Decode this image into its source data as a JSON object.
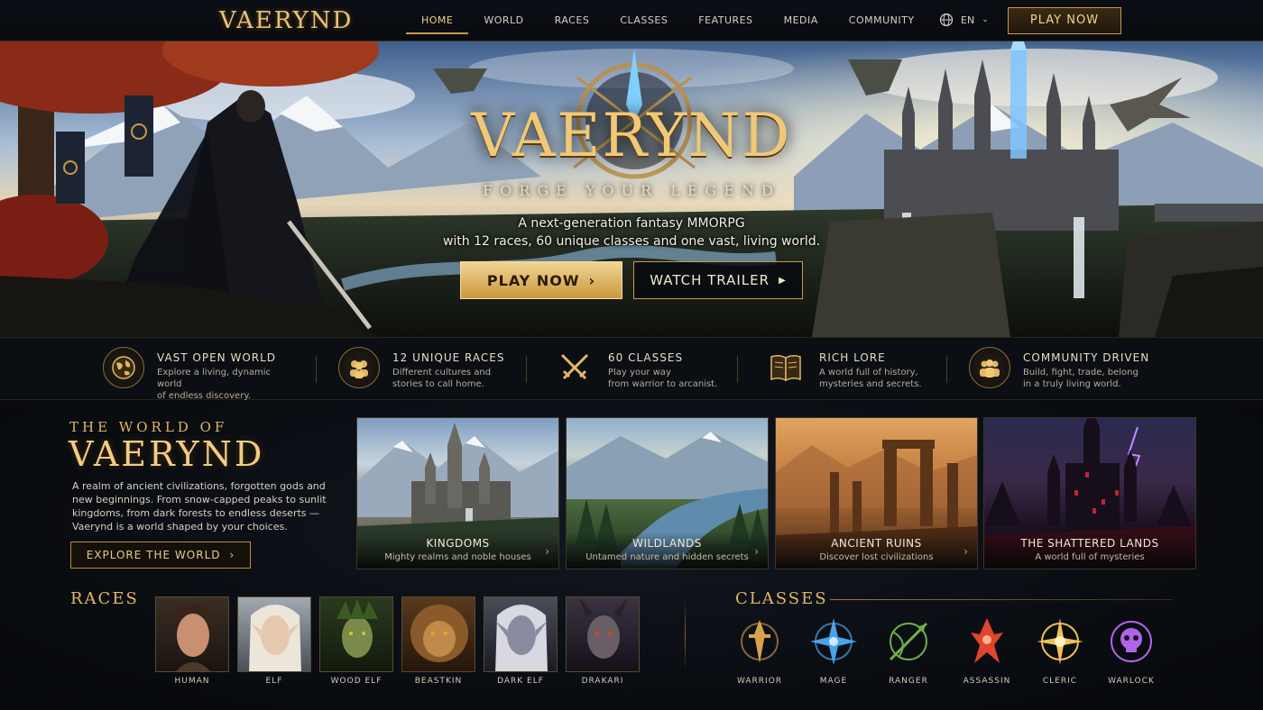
{
  "nav": {
    "logo": "VAERYND",
    "items": [
      "HOME",
      "WORLD",
      "RACES",
      "CLASSES",
      "FEATURES",
      "MEDIA",
      "COMMUNITY"
    ],
    "active": "HOME",
    "language": "EN",
    "play_label": "PLAY NOW"
  },
  "hero": {
    "title": "VAERYND",
    "tagline": "FORGE YOUR LEGEND",
    "subtitle_line1": "A next-generation fantasy MMORPG",
    "subtitle_line2": "with 12 races, 60 unique classes and one vast, living world.",
    "play_label": "PLAY NOW",
    "trailer_label": "WATCH TRAILER"
  },
  "features": [
    {
      "icon": "globe-icon",
      "title": "VAST OPEN WORLD",
      "line1": "Explore a living, dynamic world",
      "line2": "of endless discovery."
    },
    {
      "icon": "people-icon",
      "title": "12 UNIQUE RACES",
      "line1": "Different cultures and",
      "line2": "stories to call home."
    },
    {
      "icon": "crossed-swords-icon",
      "title": "60 CLASSES",
      "line1": "Play your way",
      "line2": "from warrior to arcanist."
    },
    {
      "icon": "book-icon",
      "title": "RICH LORE",
      "line1": "A world full of history,",
      "line2": "mysteries and secrets."
    },
    {
      "icon": "community-icon",
      "title": "COMMUNITY DRIVEN",
      "line1": "Build, fight, trade, belong",
      "line2": "in a truly living world."
    }
  ],
  "world": {
    "pre_title": "THE WORLD OF",
    "title": "VAERYND",
    "description": "A realm of ancient civilizations, forgotten gods and new beginnings. From snow-capped peaks to sunlit kingdoms, from dark forests to endless deserts — Vaerynd is a world shaped by your choices.",
    "explore_label": "EXPLORE THE WORLD"
  },
  "regions": [
    {
      "name": "KINGDOMS",
      "desc": "Mighty realms and noble houses"
    },
    {
      "name": "WILDLANDS",
      "desc": "Untamed nature and hidden secrets"
    },
    {
      "name": "ANCIENT RUINS",
      "desc": "Discover lost civilizations"
    },
    {
      "name": "THE SHATTERED LANDS",
      "desc": "A world full of mysteries"
    }
  ],
  "races": {
    "heading": "RACES",
    "items": [
      "HUMAN",
      "ELF",
      "WOOD ELF",
      "BEASTKIN",
      "DARK ELF",
      "DRAKARI"
    ]
  },
  "classes": {
    "heading": "CLASSES",
    "items": [
      {
        "name": "WARRIOR",
        "color": "#d9a24a"
      },
      {
        "name": "MAGE",
        "color": "#4aa3e8"
      },
      {
        "name": "RANGER",
        "color": "#6fb04a"
      },
      {
        "name": "ASSASSIN",
        "color": "#e0452e"
      },
      {
        "name": "CLERIC",
        "color": "#f0c050"
      },
      {
        "name": "WARLOCK",
        "color": "#b064e8"
      }
    ]
  }
}
